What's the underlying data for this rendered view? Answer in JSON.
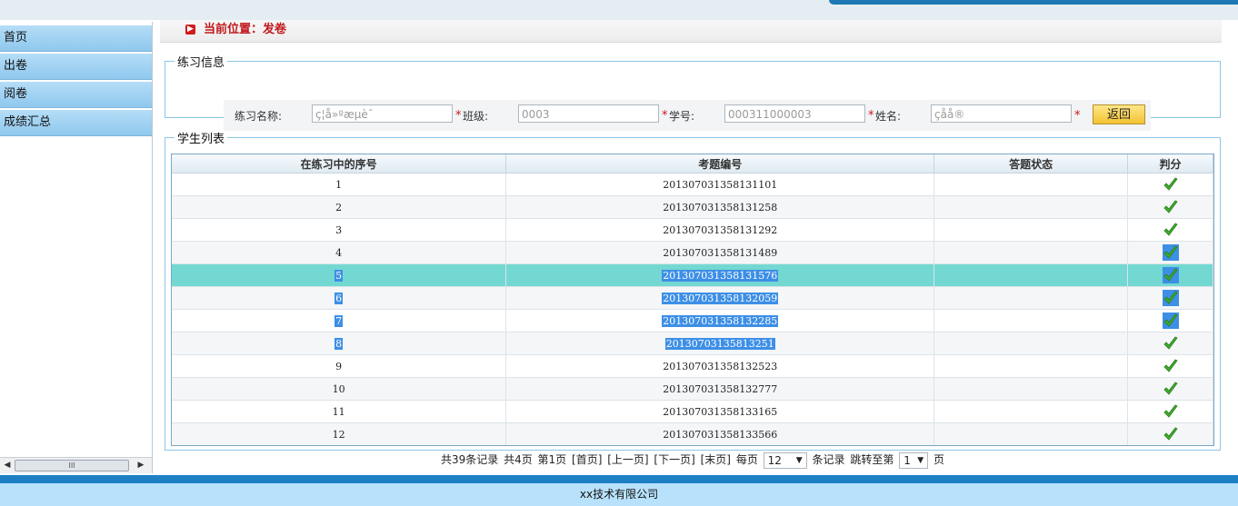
{
  "sidebar": {
    "items": [
      {
        "label": "首页"
      },
      {
        "label": "出卷"
      },
      {
        "label": "阅卷"
      },
      {
        "label": "成绩汇总"
      }
    ],
    "scrollbar_thumb_label": "III"
  },
  "location": {
    "text": "当前位置：发卷"
  },
  "info_section": {
    "legend": "练习信息",
    "name_label": "练习名称:",
    "name_value": "ç¦å»ºæµè¯",
    "class_label": "班级:",
    "class_value": "0003",
    "student_no_label": "学号:",
    "student_no_value": "000311000003",
    "student_name_label": "姓名:",
    "student_name_value": "çåå®",
    "required_mark": "*",
    "back_button": "返回"
  },
  "list_section": {
    "legend": "学生列表",
    "columns": [
      "在练习中的序号",
      "考题编号",
      "答题状态",
      "判分"
    ],
    "rows": [
      {
        "seq": "1",
        "code": "201307031358131101",
        "status": "",
        "graded": true
      },
      {
        "seq": "2",
        "code": "201307031358131258",
        "status": "",
        "graded": true
      },
      {
        "seq": "3",
        "code": "201307031358131292",
        "status": "",
        "graded": true
      },
      {
        "seq": "4",
        "code": "201307031358131489",
        "status": "",
        "graded": true
      },
      {
        "seq": "5",
        "code": "201307031358131576",
        "status": "",
        "graded": true
      },
      {
        "seq": "6",
        "code": "201307031358132059",
        "status": "",
        "graded": true
      },
      {
        "seq": "7",
        "code": "201307031358132285",
        "status": "",
        "graded": true
      },
      {
        "seq": "8",
        "code": "20130703135813251",
        "status": "",
        "graded": true
      },
      {
        "seq": "9",
        "code": "201307031358132523",
        "status": "",
        "graded": true
      },
      {
        "seq": "10",
        "code": "201307031358132777",
        "status": "",
        "graded": true
      },
      {
        "seq": "11",
        "code": "201307031358133165",
        "status": "",
        "graded": true
      },
      {
        "seq": "12",
        "code": "201307031358133566",
        "status": "",
        "graded": true
      }
    ],
    "highlighted_row": 5,
    "selected_rows": [
      5,
      6,
      7,
      8
    ],
    "selected_check_rows": [
      4,
      5,
      6,
      7
    ]
  },
  "pager": {
    "total_records": "共39条记录",
    "total_pages": "共4页",
    "current_page": "第1页",
    "first": "[首页]",
    "prev": "[上一页]",
    "next": "[下一页]",
    "last": "[末页]",
    "per_page_prefix": "每页",
    "per_page_value": "12",
    "per_page_suffix": "条记录",
    "jump_prefix": "跳转至第",
    "jump_value": "1",
    "jump_suffix": "页"
  },
  "footer": {
    "text": "xx技术有限公司"
  },
  "colors": {
    "highlight_row": "#73d8d2",
    "selection": "#3d8fe6",
    "sidebar_item": "#a2d3f3",
    "footer_stripe": "#1d80c4",
    "location_text": "#c0181c"
  }
}
